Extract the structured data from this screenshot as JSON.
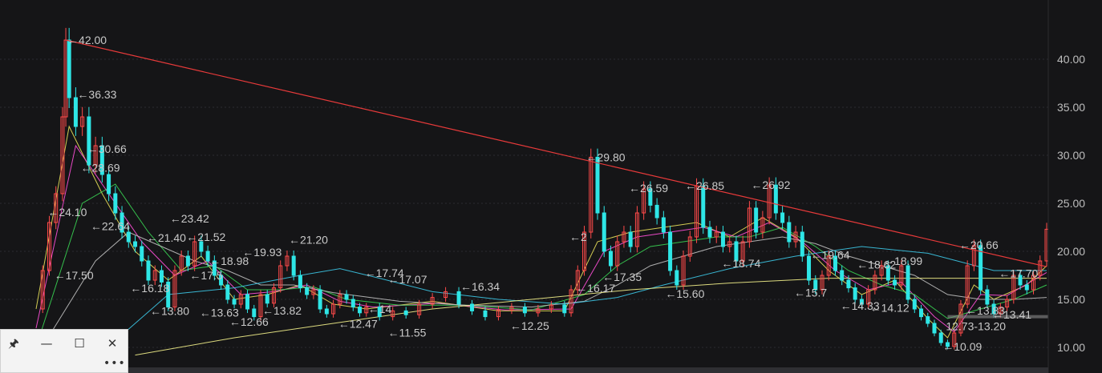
{
  "chart_data": {
    "type": "line",
    "xlabel": "",
    "ylabel": "",
    "ylim": [
      8.5,
      44.5
    ],
    "y_ticks": [
      "40.00",
      "35.00",
      "30.00",
      "25.00",
      "20.00",
      "15.00",
      "10.00"
    ],
    "grid": true,
    "price": [
      [
        0,
        14
      ],
      [
        2,
        18
      ],
      [
        4,
        23
      ],
      [
        6,
        26
      ],
      [
        8,
        34
      ],
      [
        9,
        42
      ],
      [
        10,
        36
      ],
      [
        12,
        33
      ],
      [
        14,
        34
      ],
      [
        16,
        29
      ],
      [
        18,
        31
      ],
      [
        20,
        28
      ],
      [
        22,
        26
      ],
      [
        24,
        24
      ],
      [
        26,
        22
      ],
      [
        28,
        21
      ],
      [
        30,
        20.5
      ],
      [
        32,
        19
      ],
      [
        34,
        17
      ],
      [
        36,
        18
      ],
      [
        38,
        16.8
      ],
      [
        40,
        14.2
      ],
      [
        42,
        18
      ],
      [
        44,
        19.5
      ],
      [
        46,
        18.5
      ],
      [
        48,
        21
      ],
      [
        50,
        20
      ],
      [
        52,
        19
      ],
      [
        54,
        17.5
      ],
      [
        56,
        16.5
      ],
      [
        58,
        15
      ],
      [
        60,
        14.5
      ],
      [
        62,
        15.5
      ],
      [
        64,
        14
      ],
      [
        66,
        13.2
      ],
      [
        68,
        15.5
      ],
      [
        70,
        14.6
      ],
      [
        72,
        16.2
      ],
      [
        74,
        18.5
      ],
      [
        76,
        19.5
      ],
      [
        78,
        17.5
      ],
      [
        80,
        16.2
      ],
      [
        82,
        15.5
      ],
      [
        84,
        16
      ],
      [
        86,
        14
      ],
      [
        88,
        13.5
      ],
      [
        90,
        14.5
      ],
      [
        92,
        15.5
      ],
      [
        94,
        15
      ],
      [
        96,
        14.2
      ],
      [
        98,
        13.6
      ],
      [
        100,
        14.2
      ],
      [
        104,
        13.2
      ],
      [
        108,
        13.8
      ],
      [
        112,
        13.4
      ],
      [
        116,
        14.5
      ],
      [
        120,
        15.2
      ],
      [
        124,
        15.8
      ],
      [
        128,
        14.5
      ],
      [
        132,
        13.8
      ],
      [
        136,
        13.2
      ],
      [
        140,
        13.9
      ],
      [
        144,
        14.2
      ],
      [
        148,
        13.6
      ],
      [
        152,
        14
      ],
      [
        156,
        14.4
      ],
      [
        160,
        13.6
      ],
      [
        162,
        16
      ],
      [
        164,
        18
      ],
      [
        166,
        22
      ],
      [
        168,
        29.8
      ],
      [
        170,
        24
      ],
      [
        172,
        20
      ],
      [
        174,
        18.5
      ],
      [
        176,
        21
      ],
      [
        178,
        22
      ],
      [
        180,
        20.5
      ],
      [
        182,
        24
      ],
      [
        184,
        26.5
      ],
      [
        186,
        24.8
      ],
      [
        188,
        23.5
      ],
      [
        190,
        22
      ],
      [
        192,
        18
      ],
      [
        194,
        16.5
      ],
      [
        196,
        19.5
      ],
      [
        198,
        21.5
      ],
      [
        200,
        26.8
      ],
      [
        202,
        22.5
      ],
      [
        204,
        21.5
      ],
      [
        206,
        22
      ],
      [
        208,
        20.5
      ],
      [
        210,
        21
      ],
      [
        212,
        19
      ],
      [
        214,
        21
      ],
      [
        216,
        24.5
      ],
      [
        218,
        22
      ],
      [
        220,
        23.5
      ],
      [
        222,
        26.9
      ],
      [
        224,
        24
      ],
      [
        226,
        23
      ],
      [
        228,
        21
      ],
      [
        230,
        22
      ],
      [
        232,
        19.5
      ],
      [
        234,
        17
      ],
      [
        236,
        16
      ],
      [
        238,
        17.5
      ],
      [
        240,
        19.5
      ],
      [
        242,
        18
      ],
      [
        244,
        17
      ],
      [
        246,
        16.2
      ],
      [
        248,
        15
      ],
      [
        250,
        14.5
      ],
      [
        252,
        16
      ],
      [
        254,
        17.5
      ],
      [
        256,
        18.5
      ],
      [
        258,
        17
      ],
      [
        260,
        16.5
      ],
      [
        262,
        18.5
      ],
      [
        264,
        15
      ],
      [
        266,
        14
      ],
      [
        268,
        13.2
      ],
      [
        270,
        12.5
      ],
      [
        272,
        11.5
      ],
      [
        274,
        10.5
      ],
      [
        276,
        10.1
      ],
      [
        278,
        11.5
      ],
      [
        280,
        14.5
      ],
      [
        282,
        18.5
      ],
      [
        284,
        20.6
      ],
      [
        286,
        16
      ],
      [
        288,
        14.5
      ],
      [
        290,
        13.5
      ],
      [
        292,
        14.2
      ],
      [
        294,
        15
      ],
      [
        296,
        17.5
      ],
      [
        298,
        16.5
      ],
      [
        300,
        16
      ],
      [
        302,
        17.5
      ],
      [
        304,
        19
      ],
      [
        306,
        22.3
      ]
    ],
    "series": [
      {
        "color": "#e8e05a",
        "values": [
          [
            0,
            14
          ],
          [
            10,
            33
          ],
          [
            20,
            26
          ],
          [
            30,
            20
          ],
          [
            40,
            17
          ],
          [
            50,
            19.5
          ],
          [
            60,
            15
          ],
          [
            70,
            15.5
          ],
          [
            80,
            16.5
          ],
          [
            90,
            14.5
          ],
          [
            100,
            14
          ],
          [
            120,
            14.8
          ],
          [
            140,
            13.8
          ],
          [
            160,
            13.8
          ],
          [
            170,
            21
          ],
          [
            180,
            22
          ],
          [
            190,
            22.5
          ],
          [
            200,
            23
          ],
          [
            210,
            21.5
          ],
          [
            220,
            23.5
          ],
          [
            230,
            21.5
          ],
          [
            240,
            18
          ],
          [
            250,
            15.5
          ],
          [
            260,
            17
          ],
          [
            270,
            13
          ],
          [
            276,
            11
          ],
          [
            284,
            16.5
          ],
          [
            290,
            15
          ],
          [
            300,
            16.5
          ],
          [
            306,
            18.5
          ]
        ]
      },
      {
        "color": "#ff4fd8",
        "values": [
          [
            0,
            12
          ],
          [
            12,
            31
          ],
          [
            22,
            26
          ],
          [
            32,
            21
          ],
          [
            42,
            17.5
          ],
          [
            52,
            19
          ],
          [
            62,
            15.5
          ],
          [
            72,
            15.8
          ],
          [
            82,
            16.5
          ],
          [
            92,
            14.8
          ],
          [
            102,
            14.2
          ],
          [
            122,
            14.6
          ],
          [
            142,
            13.9
          ],
          [
            162,
            14
          ],
          [
            172,
            20
          ],
          [
            182,
            21.5
          ],
          [
            192,
            22
          ],
          [
            202,
            22.5
          ],
          [
            212,
            21.5
          ],
          [
            222,
            23
          ],
          [
            232,
            21
          ],
          [
            242,
            18
          ],
          [
            252,
            16
          ],
          [
            262,
            16.8
          ],
          [
            272,
            13.2
          ],
          [
            278,
            11.6
          ],
          [
            286,
            15.5
          ],
          [
            294,
            15.4
          ],
          [
            306,
            17.8
          ]
        ]
      },
      {
        "color": "#39d353",
        "values": [
          [
            0,
            10
          ],
          [
            14,
            25
          ],
          [
            24,
            27
          ],
          [
            34,
            22
          ],
          [
            44,
            18
          ],
          [
            54,
            18.5
          ],
          [
            64,
            16
          ],
          [
            74,
            16
          ],
          [
            84,
            16.3
          ],
          [
            94,
            15
          ],
          [
            110,
            14.4
          ],
          [
            130,
            14.4
          ],
          [
            150,
            13.9
          ],
          [
            166,
            15.5
          ],
          [
            176,
            18.5
          ],
          [
            186,
            20.5
          ],
          [
            196,
            21
          ],
          [
            206,
            21.5
          ],
          [
            216,
            21.5
          ],
          [
            226,
            22.5
          ],
          [
            236,
            20.5
          ],
          [
            246,
            18
          ],
          [
            256,
            16.5
          ],
          [
            266,
            15.5
          ],
          [
            276,
            13
          ],
          [
            286,
            14
          ],
          [
            296,
            15
          ],
          [
            306,
            16.5
          ]
        ]
      },
      {
        "color": "#bfbfbf",
        "values": [
          [
            0,
            9
          ],
          [
            18,
            19
          ],
          [
            28,
            22
          ],
          [
            38,
            20.5
          ],
          [
            48,
            19
          ],
          [
            58,
            18
          ],
          [
            68,
            16.5
          ],
          [
            78,
            16.5
          ],
          [
            90,
            15.7
          ],
          [
            110,
            14.8
          ],
          [
            130,
            14.4
          ],
          [
            150,
            14.2
          ],
          [
            166,
            14.8
          ],
          [
            176,
            16.5
          ],
          [
            186,
            18.5
          ],
          [
            196,
            19.5
          ],
          [
            206,
            20.5
          ],
          [
            216,
            21
          ],
          [
            226,
            21.5
          ],
          [
            236,
            20.8
          ],
          [
            246,
            19.5
          ],
          [
            256,
            18.5
          ],
          [
            266,
            17.5
          ],
          [
            276,
            15.5
          ],
          [
            286,
            15
          ],
          [
            296,
            15
          ],
          [
            306,
            15.2
          ]
        ]
      },
      {
        "color": "#3cc6e6",
        "values": [
          [
            20,
            9.5
          ],
          [
            40,
            15.5
          ],
          [
            60,
            16.2
          ],
          [
            80,
            17.5
          ],
          [
            92,
            18.2
          ],
          [
            104,
            17.2
          ],
          [
            120,
            15.8
          ],
          [
            140,
            15
          ],
          [
            160,
            14.5
          ],
          [
            176,
            15.2
          ],
          [
            190,
            16.5
          ],
          [
            210,
            18.2
          ],
          [
            230,
            19.5
          ],
          [
            250,
            20.5
          ],
          [
            270,
            19.8
          ],
          [
            290,
            18
          ],
          [
            306,
            18
          ]
        ]
      },
      {
        "color": "#f2ef8a",
        "values": [
          [
            30,
            9.2
          ],
          [
            60,
            11
          ],
          [
            90,
            12.5
          ],
          [
            120,
            14
          ],
          [
            150,
            15
          ],
          [
            180,
            16
          ],
          [
            210,
            16.7
          ],
          [
            240,
            17.2
          ],
          [
            270,
            17.2
          ],
          [
            290,
            17.2
          ],
          [
            306,
            17.2
          ]
        ]
      }
    ],
    "trendline": {
      "color": "#e83a3a",
      "from": [
        9,
        42
      ],
      "to": [
        306,
        18.4
      ]
    },
    "support_line": {
      "color": "#8a8a8a",
      "y": 13.2,
      "from_x": 276,
      "to_x": 306
    },
    "annotations": [
      {
        "text": "←42.00",
        "x": 9,
        "y": 42
      },
      {
        "text": "←36.33",
        "x": 12,
        "y": 36.33
      },
      {
        "text": "←30.66",
        "x": 15,
        "y": 30.66
      },
      {
        "text": "←28.69",
        "x": 13,
        "y": 28.69
      },
      {
        "text": "←24.10",
        "x": 3,
        "y": 24.1
      },
      {
        "text": "←22.64",
        "x": 16,
        "y": 22.64
      },
      {
        "text": "←23.42",
        "x": 40,
        "y": 23.42
      },
      {
        "text": "←21.40",
        "x": 33,
        "y": 21.4
      },
      {
        "text": "←21.52",
        "x": 45,
        "y": 21.52
      },
      {
        "text": "←18.98",
        "x": 52,
        "y": 18.98
      },
      {
        "text": "←19.93",
        "x": 62,
        "y": 19.93
      },
      {
        "text": "←21.20",
        "x": 76,
        "y": 21.2
      },
      {
        "text": "←17.50",
        "x": 5,
        "y": 17.5
      },
      {
        "text": "←16.18",
        "x": 28,
        "y": 16.18
      },
      {
        "text": "←17.5",
        "x": 46,
        "y": 17.5
      },
      {
        "text": "←13.80",
        "x": 34,
        "y": 13.8
      },
      {
        "text": "←13.63",
        "x": 49,
        "y": 13.63
      },
      {
        "text": "←12.66",
        "x": 58,
        "y": 12.66
      },
      {
        "text": "←13.82",
        "x": 68,
        "y": 13.82
      },
      {
        "text": "←17.74",
        "x": 99,
        "y": 17.74
      },
      {
        "text": "←17.07",
        "x": 106,
        "y": 17.07
      },
      {
        "text": "←16.34",
        "x": 128,
        "y": 16.34
      },
      {
        "text": "←14",
        "x": 100,
        "y": 14
      },
      {
        "text": "←12.47",
        "x": 91,
        "y": 12.47
      },
      {
        "text": "←11.55",
        "x": 106,
        "y": 11.55
      },
      {
        "text": "←12.25",
        "x": 143,
        "y": 12.25
      },
      {
        "text": "←29.80",
        "x": 166,
        "y": 29.8
      },
      {
        "text": "←2",
        "x": 161,
        "y": 21.5
      },
      {
        "text": "←17.35",
        "x": 171,
        "y": 17.35
      },
      {
        "text": "←16.17",
        "x": 163,
        "y": 16.17
      },
      {
        "text": "←26.59",
        "x": 179,
        "y": 26.59
      },
      {
        "text": "←15.60",
        "x": 190,
        "y": 15.6
      },
      {
        "text": "←26.85",
        "x": 196,
        "y": 26.85
      },
      {
        "text": "←26.92",
        "x": 216,
        "y": 26.92
      },
      {
        "text": "←18.74",
        "x": 207,
        "y": 18.74
      },
      {
        "text": "←19.64",
        "x": 234,
        "y": 19.64
      },
      {
        "text": "←15.7",
        "x": 229,
        "y": 15.7
      },
      {
        "text": "←14.33",
        "x": 243,
        "y": 14.33
      },
      {
        "text": "←18.62",
        "x": 248,
        "y": 18.62
      },
      {
        "text": "←18.99",
        "x": 256,
        "y": 18.99
      },
      {
        "text": "←14.12",
        "x": 252,
        "y": 14.12
      },
      {
        "text": "←20.66",
        "x": 279,
        "y": 20.66
      },
      {
        "text": "←10.09",
        "x": 274,
        "y": 10.09
      },
      {
        "text": "12.73-13.20",
        "x": 275,
        "y": 12.2
      },
      {
        "text": "←13.83",
        "x": 281,
        "y": 13.83
      },
      {
        "text": "←13.41",
        "x": 289,
        "y": 13.41
      },
      {
        "text": "←17.70",
        "x": 291,
        "y": 17.7
      }
    ]
  },
  "window_controls": {
    "pin": "🖈",
    "minimize": "—",
    "maximize": "☐",
    "close": "✕",
    "more": "•••"
  }
}
